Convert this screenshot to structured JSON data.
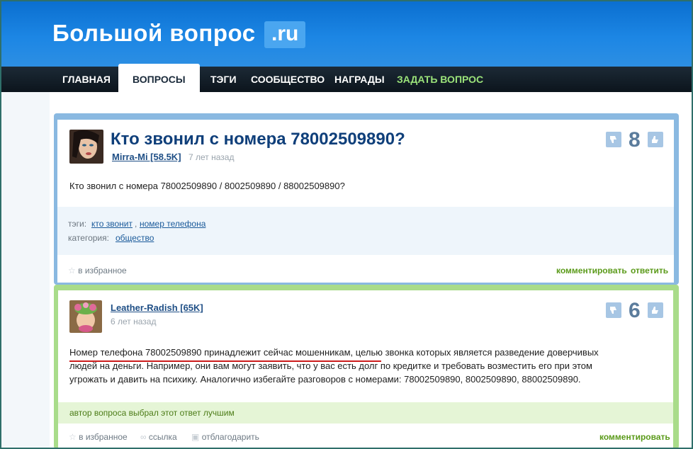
{
  "site": {
    "logo_text": "Большой вопрос",
    "logo_badge": ".ru"
  },
  "nav": {
    "items": [
      "ГЛАВНАЯ",
      "ВОПРОСЫ",
      "ТЭГИ",
      "СООБЩЕСТВО",
      "НАГРАДЫ",
      "ЗАДАТЬ ВОПРОС"
    ],
    "active": "ВОПРОСЫ"
  },
  "question": {
    "title": "Кто звонил с номера 78002509890?",
    "author": "Mirra-Mi [58.5K]",
    "time": "7 лет назад",
    "votes": "8",
    "body": "Кто звонил с номера 78002509890 / 8002509890 / 88002509890?",
    "tags_label": "тэги:",
    "tags": [
      "кто звонит",
      "номер телефона"
    ],
    "category_label": "категория:",
    "category": "общество",
    "fav": "в избранное",
    "comment": "комментировать",
    "answer": "ответить"
  },
  "answer": {
    "author": "Leather-Radish [65K]",
    "time": "6 лет назад",
    "votes": "6",
    "body_lines": [
      "Номер телефона 78002509890 принадлежит сейчас мошенникам, целью звонка которых является разведение доверчивых",
      "людей на деньги. Например, они вам могут заявить, что у вас есть долг по кредитке и требовать возместить его при этом",
      "угрожать и давить на психику. Аналогично избегайте разговоров с номерами: 78002509890, 8002509890, 88002509890."
    ],
    "best_note": "автор вопроса выбрал этот ответ лучшим",
    "fav": "в избранное",
    "link": "ссылка",
    "thank": "отблагодарить",
    "comment": "комментировать"
  },
  "colors": {
    "header": "#1c86e4",
    "nav": "#0c141c",
    "question_border": "#8ab9e1",
    "answer_border": "#a9dc8a",
    "accent_green": "#5a9a19"
  }
}
